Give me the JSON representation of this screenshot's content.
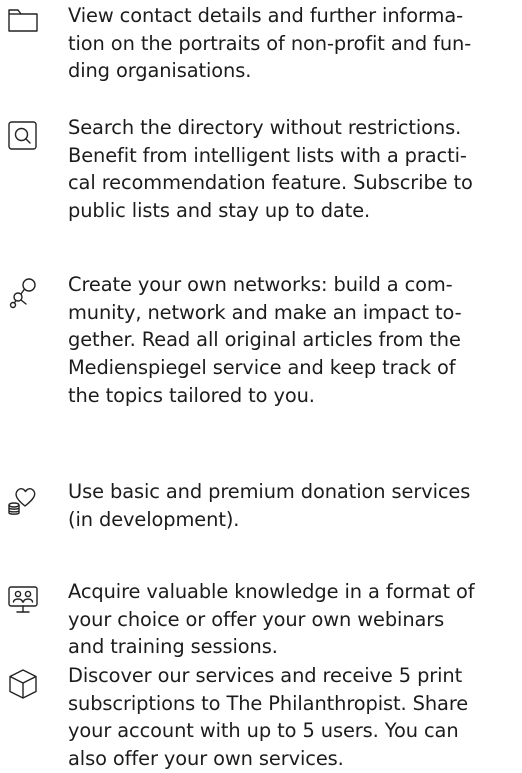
{
  "features": [
    {
      "icon": "folder-icon",
      "text": "View contact details and further informa-\ntion on the portraits of non-profit and fun-\nding organisations."
    },
    {
      "icon": "search-icon",
      "text": "Search the directory without restrictions.\nBenefit from intelligent lists with a practi-\ncal recommendation feature. Subscribe to\npublic lists and stay up to date."
    },
    {
      "icon": "network-icon",
      "text": "Create your own networks: build a com-\nmunity, network and make an impact to-\ngether. Read all original articles from the\nMedienspiegel service and keep track of\nthe topics tailored to you."
    },
    {
      "icon": "donation-icon",
      "text": "Use basic and premium donation services\n(in development)."
    },
    {
      "icon": "webinar-icon",
      "text": "Acquire valuable knowledge in a format of\nyour choice or offer your own webinars\nand training sessions."
    },
    {
      "icon": "package-icon",
      "text": "Discover our services and receive 5 print\nsubscriptions to The Philanthropist. Share\nyour account with up to 5 users. You can\nalso offer your own services."
    }
  ],
  "colors": {
    "text": "#1c1c1c",
    "icon_stroke": "#222222",
    "background": "#ffffff"
  }
}
